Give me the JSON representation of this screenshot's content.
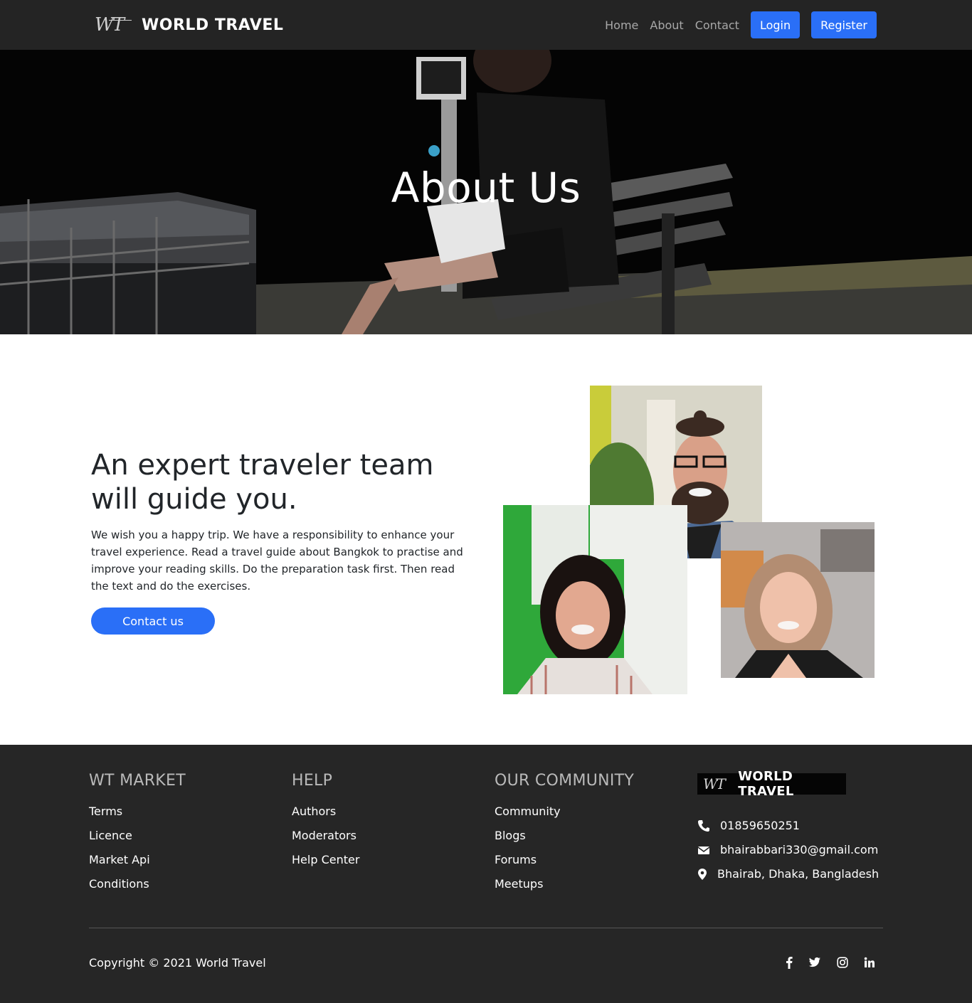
{
  "nav": {
    "brand_mark": "WT",
    "brand_name": "WORLD TRAVEL",
    "links": [
      "Home",
      "About",
      "Contact"
    ],
    "login_label": "Login",
    "register_label": "Register"
  },
  "hero": {
    "title": "About Us"
  },
  "about": {
    "heading": "An expert traveler team will guide you.",
    "body": "We wish you a happy trip. We have a responsibility to enhance your travel experience. Read a travel guide about Bangkok to practise and improve your reading skills. Do the preparation task first. Then read the text and do the exercises.",
    "button_label": "Contact us"
  },
  "footer": {
    "columns": [
      {
        "title": "WT MARKET",
        "links": [
          "Terms",
          "Licence",
          "Market Api",
          "Conditions"
        ]
      },
      {
        "title": "HELP",
        "links": [
          "Authors",
          "Moderators",
          "Help Center"
        ]
      },
      {
        "title": "OUR COMMUNITY",
        "links": [
          "Community",
          "Blogs",
          "Forums",
          "Meetups"
        ]
      }
    ],
    "logo_mark": "WT",
    "logo_name": "WORLD TRAVEL",
    "phone": "01859650251",
    "email": "bhairabbari330@gmail.com",
    "address": "Bhairab, Dhaka, Bangladesh",
    "copyright": "Copyright © 2021 World Travel",
    "social_icons": [
      "facebook-icon",
      "twitter-icon",
      "instagram-icon",
      "linkedin-icon"
    ]
  },
  "colors": {
    "nav_bg": "#242424",
    "accent": "#2a6ff7",
    "footer_bg": "#262626"
  }
}
